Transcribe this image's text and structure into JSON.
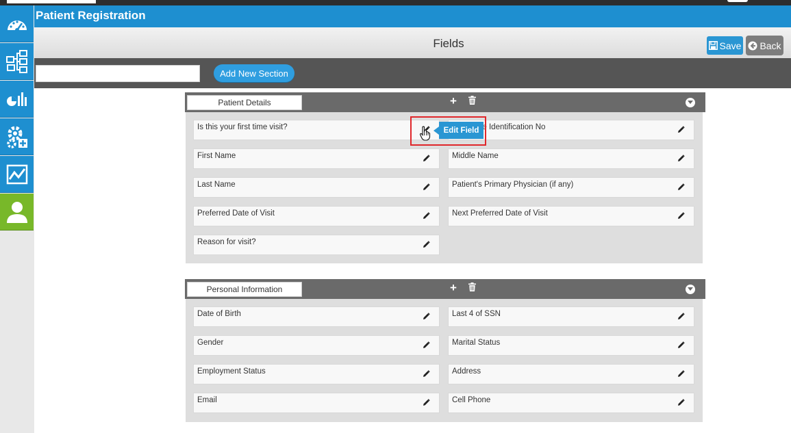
{
  "header": {
    "title": "Patient Registration"
  },
  "fields_bar": {
    "title": "Fields",
    "save_label": "Save",
    "back_label": "Back"
  },
  "toolbar": {
    "search_value": "",
    "add_section_label": "Add New Section"
  },
  "sidebar": {
    "items": [
      {
        "icon": "dashboard-icon",
        "active": false
      },
      {
        "icon": "workflow-icon",
        "active": false
      },
      {
        "icon": "reports-icon",
        "active": false
      },
      {
        "icon": "settings-icon",
        "active": false
      },
      {
        "icon": "analytics-icon",
        "active": false
      },
      {
        "icon": "user-icon",
        "active": true
      }
    ]
  },
  "sections": [
    {
      "name": "Patient Details",
      "fields": [
        {
          "label": "Is this your first time visit?"
        },
        {
          "label": "ue Identification No"
        },
        {
          "label": "First Name"
        },
        {
          "label": "Middle Name"
        },
        {
          "label": "Last Name"
        },
        {
          "label": "Patient's Primary Physician (if any)"
        },
        {
          "label": "Preferred Date of Visit"
        },
        {
          "label": "Next Preferred Date of Visit"
        },
        {
          "label": "Reason for visit?"
        }
      ]
    },
    {
      "name": "Personal Information",
      "fields": [
        {
          "label": "Date of Birth"
        },
        {
          "label": "Last 4 of SSN"
        },
        {
          "label": "Gender"
        },
        {
          "label": "Marital Status"
        },
        {
          "label": "Employment Status"
        },
        {
          "label": "Address"
        },
        {
          "label": "Email"
        },
        {
          "label": "Cell Phone"
        }
      ]
    }
  ],
  "tooltip": {
    "text": "Edit Field"
  },
  "colors": {
    "primary": "#1e8fd0",
    "active": "#78b829",
    "highlight": "#e0262a"
  }
}
